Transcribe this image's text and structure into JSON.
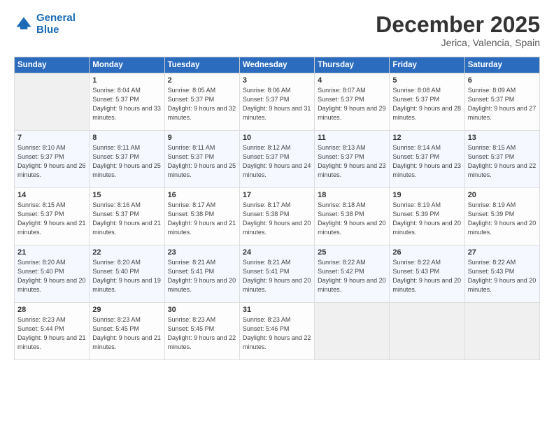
{
  "logo": {
    "line1": "General",
    "line2": "Blue"
  },
  "header": {
    "month": "December 2025",
    "location": "Jerica, Valencia, Spain"
  },
  "weekdays": [
    "Sunday",
    "Monday",
    "Tuesday",
    "Wednesday",
    "Thursday",
    "Friday",
    "Saturday"
  ],
  "weeks": [
    [
      {
        "day": "",
        "sunrise": "",
        "sunset": "",
        "daylight": ""
      },
      {
        "day": "1",
        "sunrise": "Sunrise: 8:04 AM",
        "sunset": "Sunset: 5:37 PM",
        "daylight": "Daylight: 9 hours and 33 minutes."
      },
      {
        "day": "2",
        "sunrise": "Sunrise: 8:05 AM",
        "sunset": "Sunset: 5:37 PM",
        "daylight": "Daylight: 9 hours and 32 minutes."
      },
      {
        "day": "3",
        "sunrise": "Sunrise: 8:06 AM",
        "sunset": "Sunset: 5:37 PM",
        "daylight": "Daylight: 9 hours and 31 minutes."
      },
      {
        "day": "4",
        "sunrise": "Sunrise: 8:07 AM",
        "sunset": "Sunset: 5:37 PM",
        "daylight": "Daylight: 9 hours and 29 minutes."
      },
      {
        "day": "5",
        "sunrise": "Sunrise: 8:08 AM",
        "sunset": "Sunset: 5:37 PM",
        "daylight": "Daylight: 9 hours and 28 minutes."
      },
      {
        "day": "6",
        "sunrise": "Sunrise: 8:09 AM",
        "sunset": "Sunset: 5:37 PM",
        "daylight": "Daylight: 9 hours and 27 minutes."
      }
    ],
    [
      {
        "day": "7",
        "sunrise": "Sunrise: 8:10 AM",
        "sunset": "Sunset: 5:37 PM",
        "daylight": "Daylight: 9 hours and 26 minutes."
      },
      {
        "day": "8",
        "sunrise": "Sunrise: 8:11 AM",
        "sunset": "Sunset: 5:37 PM",
        "daylight": "Daylight: 9 hours and 25 minutes."
      },
      {
        "day": "9",
        "sunrise": "Sunrise: 8:11 AM",
        "sunset": "Sunset: 5:37 PM",
        "daylight": "Daylight: 9 hours and 25 minutes."
      },
      {
        "day": "10",
        "sunrise": "Sunrise: 8:12 AM",
        "sunset": "Sunset: 5:37 PM",
        "daylight": "Daylight: 9 hours and 24 minutes."
      },
      {
        "day": "11",
        "sunrise": "Sunrise: 8:13 AM",
        "sunset": "Sunset: 5:37 PM",
        "daylight": "Daylight: 9 hours and 23 minutes."
      },
      {
        "day": "12",
        "sunrise": "Sunrise: 8:14 AM",
        "sunset": "Sunset: 5:37 PM",
        "daylight": "Daylight: 9 hours and 23 minutes."
      },
      {
        "day": "13",
        "sunrise": "Sunrise: 8:15 AM",
        "sunset": "Sunset: 5:37 PM",
        "daylight": "Daylight: 9 hours and 22 minutes."
      }
    ],
    [
      {
        "day": "14",
        "sunrise": "Sunrise: 8:15 AM",
        "sunset": "Sunset: 5:37 PM",
        "daylight": "Daylight: 9 hours and 21 minutes."
      },
      {
        "day": "15",
        "sunrise": "Sunrise: 8:16 AM",
        "sunset": "Sunset: 5:37 PM",
        "daylight": "Daylight: 9 hours and 21 minutes."
      },
      {
        "day": "16",
        "sunrise": "Sunrise: 8:17 AM",
        "sunset": "Sunset: 5:38 PM",
        "daylight": "Daylight: 9 hours and 21 minutes."
      },
      {
        "day": "17",
        "sunrise": "Sunrise: 8:17 AM",
        "sunset": "Sunset: 5:38 PM",
        "daylight": "Daylight: 9 hours and 20 minutes."
      },
      {
        "day": "18",
        "sunrise": "Sunrise: 8:18 AM",
        "sunset": "Sunset: 5:38 PM",
        "daylight": "Daylight: 9 hours and 20 minutes."
      },
      {
        "day": "19",
        "sunrise": "Sunrise: 8:19 AM",
        "sunset": "Sunset: 5:39 PM",
        "daylight": "Daylight: 9 hours and 20 minutes."
      },
      {
        "day": "20",
        "sunrise": "Sunrise: 8:19 AM",
        "sunset": "Sunset: 5:39 PM",
        "daylight": "Daylight: 9 hours and 20 minutes."
      }
    ],
    [
      {
        "day": "21",
        "sunrise": "Sunrise: 8:20 AM",
        "sunset": "Sunset: 5:40 PM",
        "daylight": "Daylight: 9 hours and 20 minutes."
      },
      {
        "day": "22",
        "sunrise": "Sunrise: 8:20 AM",
        "sunset": "Sunset: 5:40 PM",
        "daylight": "Daylight: 9 hours and 19 minutes."
      },
      {
        "day": "23",
        "sunrise": "Sunrise: 8:21 AM",
        "sunset": "Sunset: 5:41 PM",
        "daylight": "Daylight: 9 hours and 20 minutes."
      },
      {
        "day": "24",
        "sunrise": "Sunrise: 8:21 AM",
        "sunset": "Sunset: 5:41 PM",
        "daylight": "Daylight: 9 hours and 20 minutes."
      },
      {
        "day": "25",
        "sunrise": "Sunrise: 8:22 AM",
        "sunset": "Sunset: 5:42 PM",
        "daylight": "Daylight: 9 hours and 20 minutes."
      },
      {
        "day": "26",
        "sunrise": "Sunrise: 8:22 AM",
        "sunset": "Sunset: 5:43 PM",
        "daylight": "Daylight: 9 hours and 20 minutes."
      },
      {
        "day": "27",
        "sunrise": "Sunrise: 8:22 AM",
        "sunset": "Sunset: 5:43 PM",
        "daylight": "Daylight: 9 hours and 20 minutes."
      }
    ],
    [
      {
        "day": "28",
        "sunrise": "Sunrise: 8:23 AM",
        "sunset": "Sunset: 5:44 PM",
        "daylight": "Daylight: 9 hours and 21 minutes."
      },
      {
        "day": "29",
        "sunrise": "Sunrise: 8:23 AM",
        "sunset": "Sunset: 5:45 PM",
        "daylight": "Daylight: 9 hours and 21 minutes."
      },
      {
        "day": "30",
        "sunrise": "Sunrise: 8:23 AM",
        "sunset": "Sunset: 5:45 PM",
        "daylight": "Daylight: 9 hours and 22 minutes."
      },
      {
        "day": "31",
        "sunrise": "Sunrise: 8:23 AM",
        "sunset": "Sunset: 5:46 PM",
        "daylight": "Daylight: 9 hours and 22 minutes."
      },
      {
        "day": "",
        "sunrise": "",
        "sunset": "",
        "daylight": ""
      },
      {
        "day": "",
        "sunrise": "",
        "sunset": "",
        "daylight": ""
      },
      {
        "day": "",
        "sunrise": "",
        "sunset": "",
        "daylight": ""
      }
    ]
  ]
}
